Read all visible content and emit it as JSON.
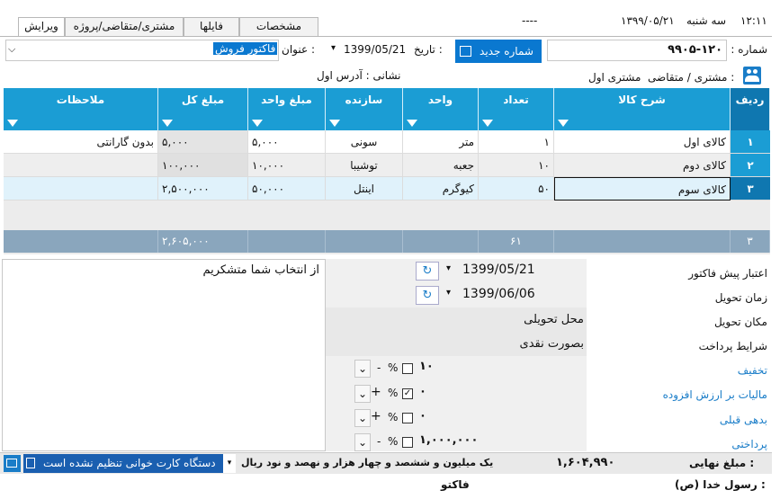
{
  "topbar": {
    "time": "۱۲:۱۱",
    "day": "سه شنبه",
    "date": "۱۳۹۹/۰۵/۲۱",
    "placeholder": "----"
  },
  "tabs": [
    {
      "label": "ویرایش",
      "active": true
    },
    {
      "label": "مشتری/متقاضی/پروژه",
      "active": false
    },
    {
      "label": "فایلها",
      "active": false
    },
    {
      "label": "مشخصات",
      "active": false
    }
  ],
  "header": {
    "number_label": "شماره :",
    "number_value": "۹۹۰۵-۱۲۰",
    "new_number_label": "شماره جدید",
    "date_label": "تاریخ :",
    "date_value": "1399/05/21",
    "title_label": "عنوان :",
    "title_value": "فاکتور فروش",
    "customer_label": "مشتری / متقاضی :",
    "customer_value": "مشتری اول",
    "address_text": "نشانی : آدرس اول"
  },
  "table": {
    "columns": [
      "ردیف",
      "شرح کالا",
      "تعداد",
      "واحد",
      "سازنده",
      "مبلغ واحد",
      "مبلغ کل",
      "ملاحظات"
    ],
    "rows": [
      {
        "no": "۱",
        "desc": "کالای اول",
        "qty": "۱",
        "unit": "متر",
        "maker": "سونی",
        "unit_price": "۵,۰۰۰",
        "total": "۵,۰۰۰",
        "note": "بدون گارانتی"
      },
      {
        "no": "۲",
        "desc": "کالای دوم",
        "qty": "۱۰",
        "unit": "جعبه",
        "maker": "توشیبا",
        "unit_price": "۱۰,۰۰۰",
        "total": "۱۰۰,۰۰۰",
        "note": ""
      },
      {
        "no": "۳",
        "desc": "کالای سوم",
        "qty": "۵۰",
        "unit": "کیوگرم",
        "maker": "اینتل",
        "unit_price": "۵۰,۰۰۰",
        "total": "۲,۵۰۰,۰۰۰",
        "note": ""
      }
    ],
    "summary": {
      "count": "۳",
      "qty_total": "۶۱",
      "grand_total": "۲,۶۰۵,۰۰۰"
    }
  },
  "details": {
    "validity_label": "اعتبار پیش فاکتور",
    "validity_value": "1399/05/21",
    "delivery_time_label": "زمان تحویل",
    "delivery_time_value": "1399/06/06",
    "delivery_place_label": "مکان تحویل",
    "delivery_place_value": "محل تحویلی",
    "payment_terms_label": "شرایط پرداخت",
    "payment_terms_value": "بصورت نقدی",
    "discount_label": "تخفیف",
    "discount_value": "۱۰",
    "vat_label": "مالیات بر ارزش افزوده",
    "vat_value": "۰",
    "prev_debt_label": "بدهی قبلی",
    "prev_debt_value": "۰",
    "payment_label": "پرداختی",
    "payment_value": "۱,۰۰۰,۰۰۰",
    "percent": "%",
    "note_text": "از انتخاب شما متشکریم"
  },
  "status": {
    "final_label": "مبلغ نهایی :",
    "final_value": "۱,۶۰۴,۹۹۰",
    "final_words": "یک میلیون و ششصد و  چهار هزار و نهصد و نود ریال",
    "card_reader": "دستگاه کارت خوانی تنظیم نشده است",
    "footer_left": "فاکتو",
    "footer_right": "رسول خدا (ص) :"
  }
}
